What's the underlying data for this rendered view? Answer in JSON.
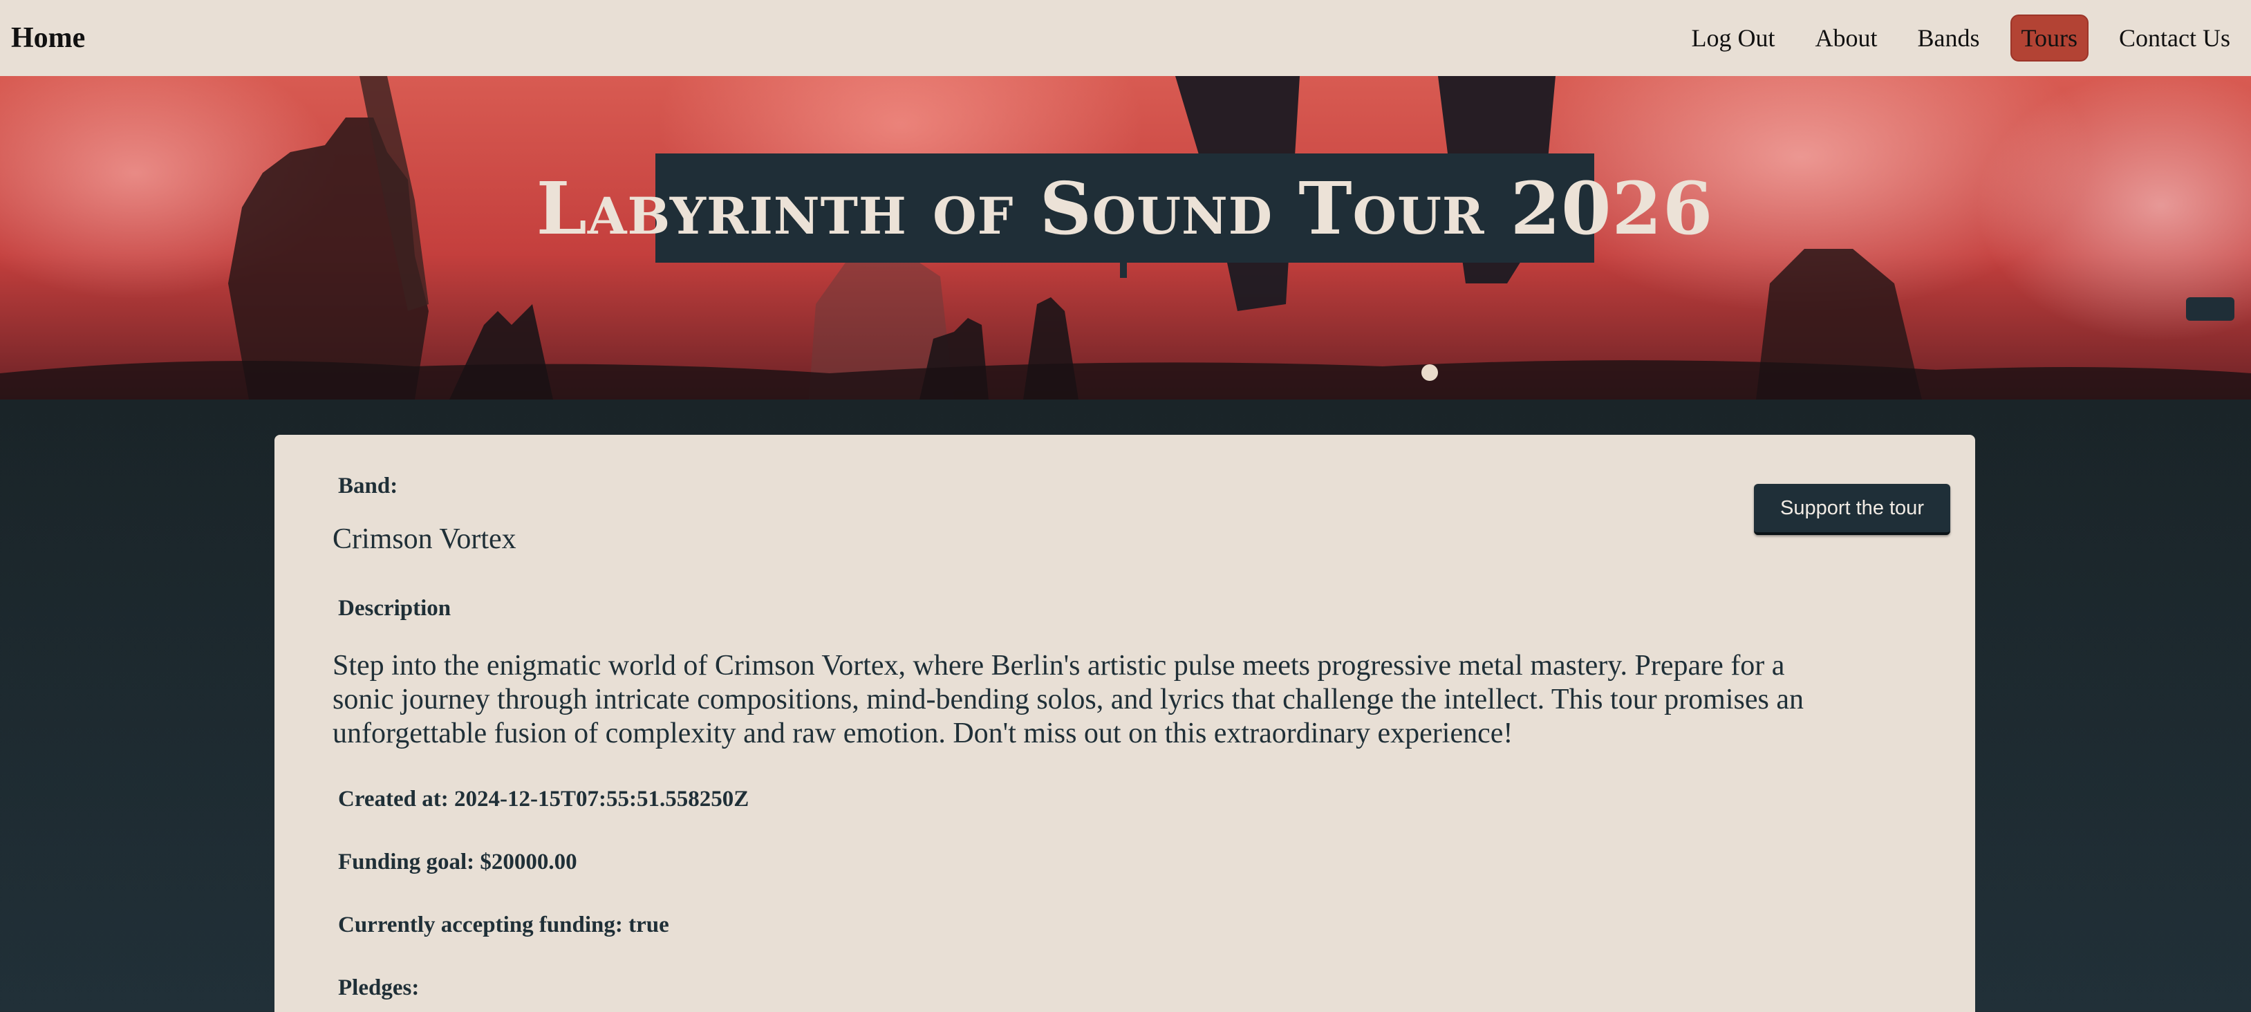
{
  "navbar": {
    "brand": "Home",
    "links": [
      {
        "label": "Log Out",
        "active": false
      },
      {
        "label": "About",
        "active": false
      },
      {
        "label": "Bands",
        "active": false
      },
      {
        "label": "Tours",
        "active": true
      },
      {
        "label": "Contact Us",
        "active": false
      }
    ],
    "active_color": "#b34334",
    "background": "#e8dfd5"
  },
  "hero": {
    "title": "Labyrinth of Sound Tour 2026"
  },
  "tour": {
    "band_label": "Band:",
    "band_name": "Crimson Vortex",
    "description_label": "Description",
    "description": "Step into the enigmatic world of Crimson Vortex, where Berlin's artistic pulse meets progressive metal mastery. Prepare for a sonic journey through intricate compositions, mind-bending solos, and lyrics that challenge the intellect. This tour promises an unforgettable fusion of complexity and raw emotion. Don't miss out on this extraordinary experience!",
    "created_at": "Created at: 2024-12-15T07:55:51.558250Z",
    "funding_goal": "Funding goal: $20000.00",
    "accepting_funding": "Currently accepting funding: true",
    "pledges_label": "Pledges:",
    "support_button": "Support the tour"
  },
  "colors": {
    "dark": "#1f2f37",
    "cream": "#e8dfd5",
    "accent": "#b34334"
  }
}
